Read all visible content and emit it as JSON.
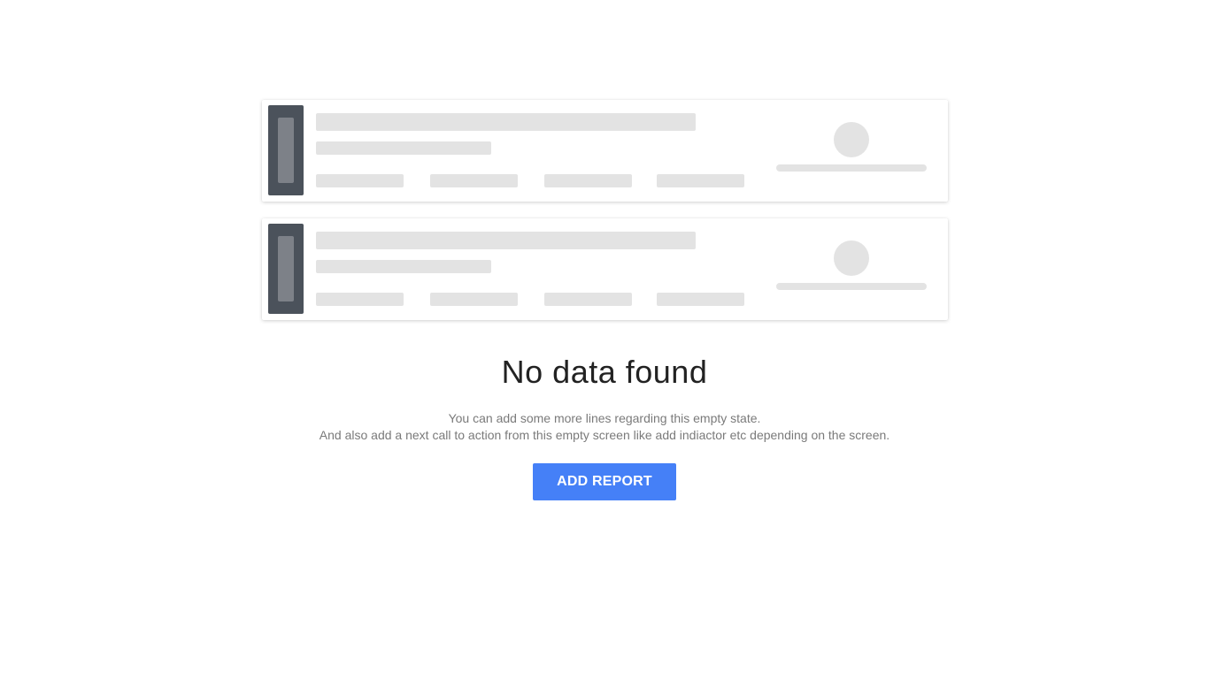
{
  "skeleton_cards_count": 2,
  "empty_state": {
    "title": "No data found",
    "description_line1": "You can add some more lines regarding this empty state.",
    "description_line2": "And also add a next call to action from this empty screen like add indiactor etc depending on the screen."
  },
  "actions": {
    "add_report_label": "ADD REPORT"
  },
  "colors": {
    "primary_button": "#4580f7",
    "skeleton": "#e3e3e3",
    "thumbnail": "#4b525b"
  }
}
